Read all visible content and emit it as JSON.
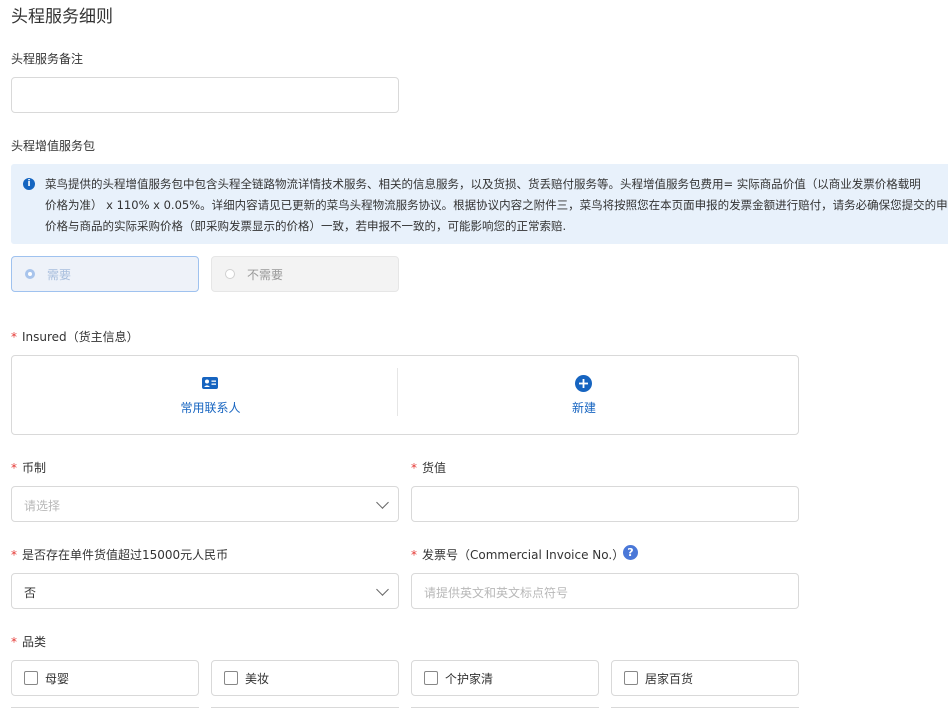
{
  "page": {
    "title": "头程服务细则"
  },
  "remark": {
    "label": "头程服务备注",
    "value": ""
  },
  "value_added": {
    "label": "头程增值服务包",
    "notice_lines": [
      "菜鸟提供的头程增值服务包中包含头程全链路物流详情技术服务、相关的信息服务，以及货损、货丢赔付服务等。头程增值服务包费用= 实际商品价值（以商业发票价格载明",
      "价格为准） x 110% x 0.05%。详细内容请见已更新的菜鸟头程物流服务协议。根据协议内容之附件三，菜鸟将按照您在本页面申报的发票金额进行赔付，请务必确保您提交的申",
      "价格与商品的实际采购价格（即采购发票显示的价格）一致，若申报不一致的，可能影响您的正常索赔."
    ],
    "options": [
      {
        "label": "需要",
        "selected": true
      },
      {
        "label": "不需要",
        "selected": false
      }
    ]
  },
  "insured": {
    "label": "Insured（货主信息）",
    "actions": [
      {
        "label": "常用联系人",
        "icon": "contact-card-icon"
      },
      {
        "label": "新建",
        "icon": "add-circle-icon"
      }
    ]
  },
  "currency": {
    "label": "币制",
    "placeholder": "请选择"
  },
  "goods_value": {
    "label": "货值",
    "value": ""
  },
  "over_limit": {
    "label": "是否存在单件货值超过15000元人民币",
    "value": "否"
  },
  "invoice_no": {
    "label": "发票号（Commercial Invoice No.）",
    "placeholder": "请提供英文和英文标点符号"
  },
  "category": {
    "label": "品类",
    "options": [
      "母婴",
      "美妆",
      "个护家清",
      "居家百货"
    ]
  },
  "colors": {
    "accent": "#1664c0",
    "required": "#e53935",
    "notice_bg": "#e8f1fb"
  }
}
